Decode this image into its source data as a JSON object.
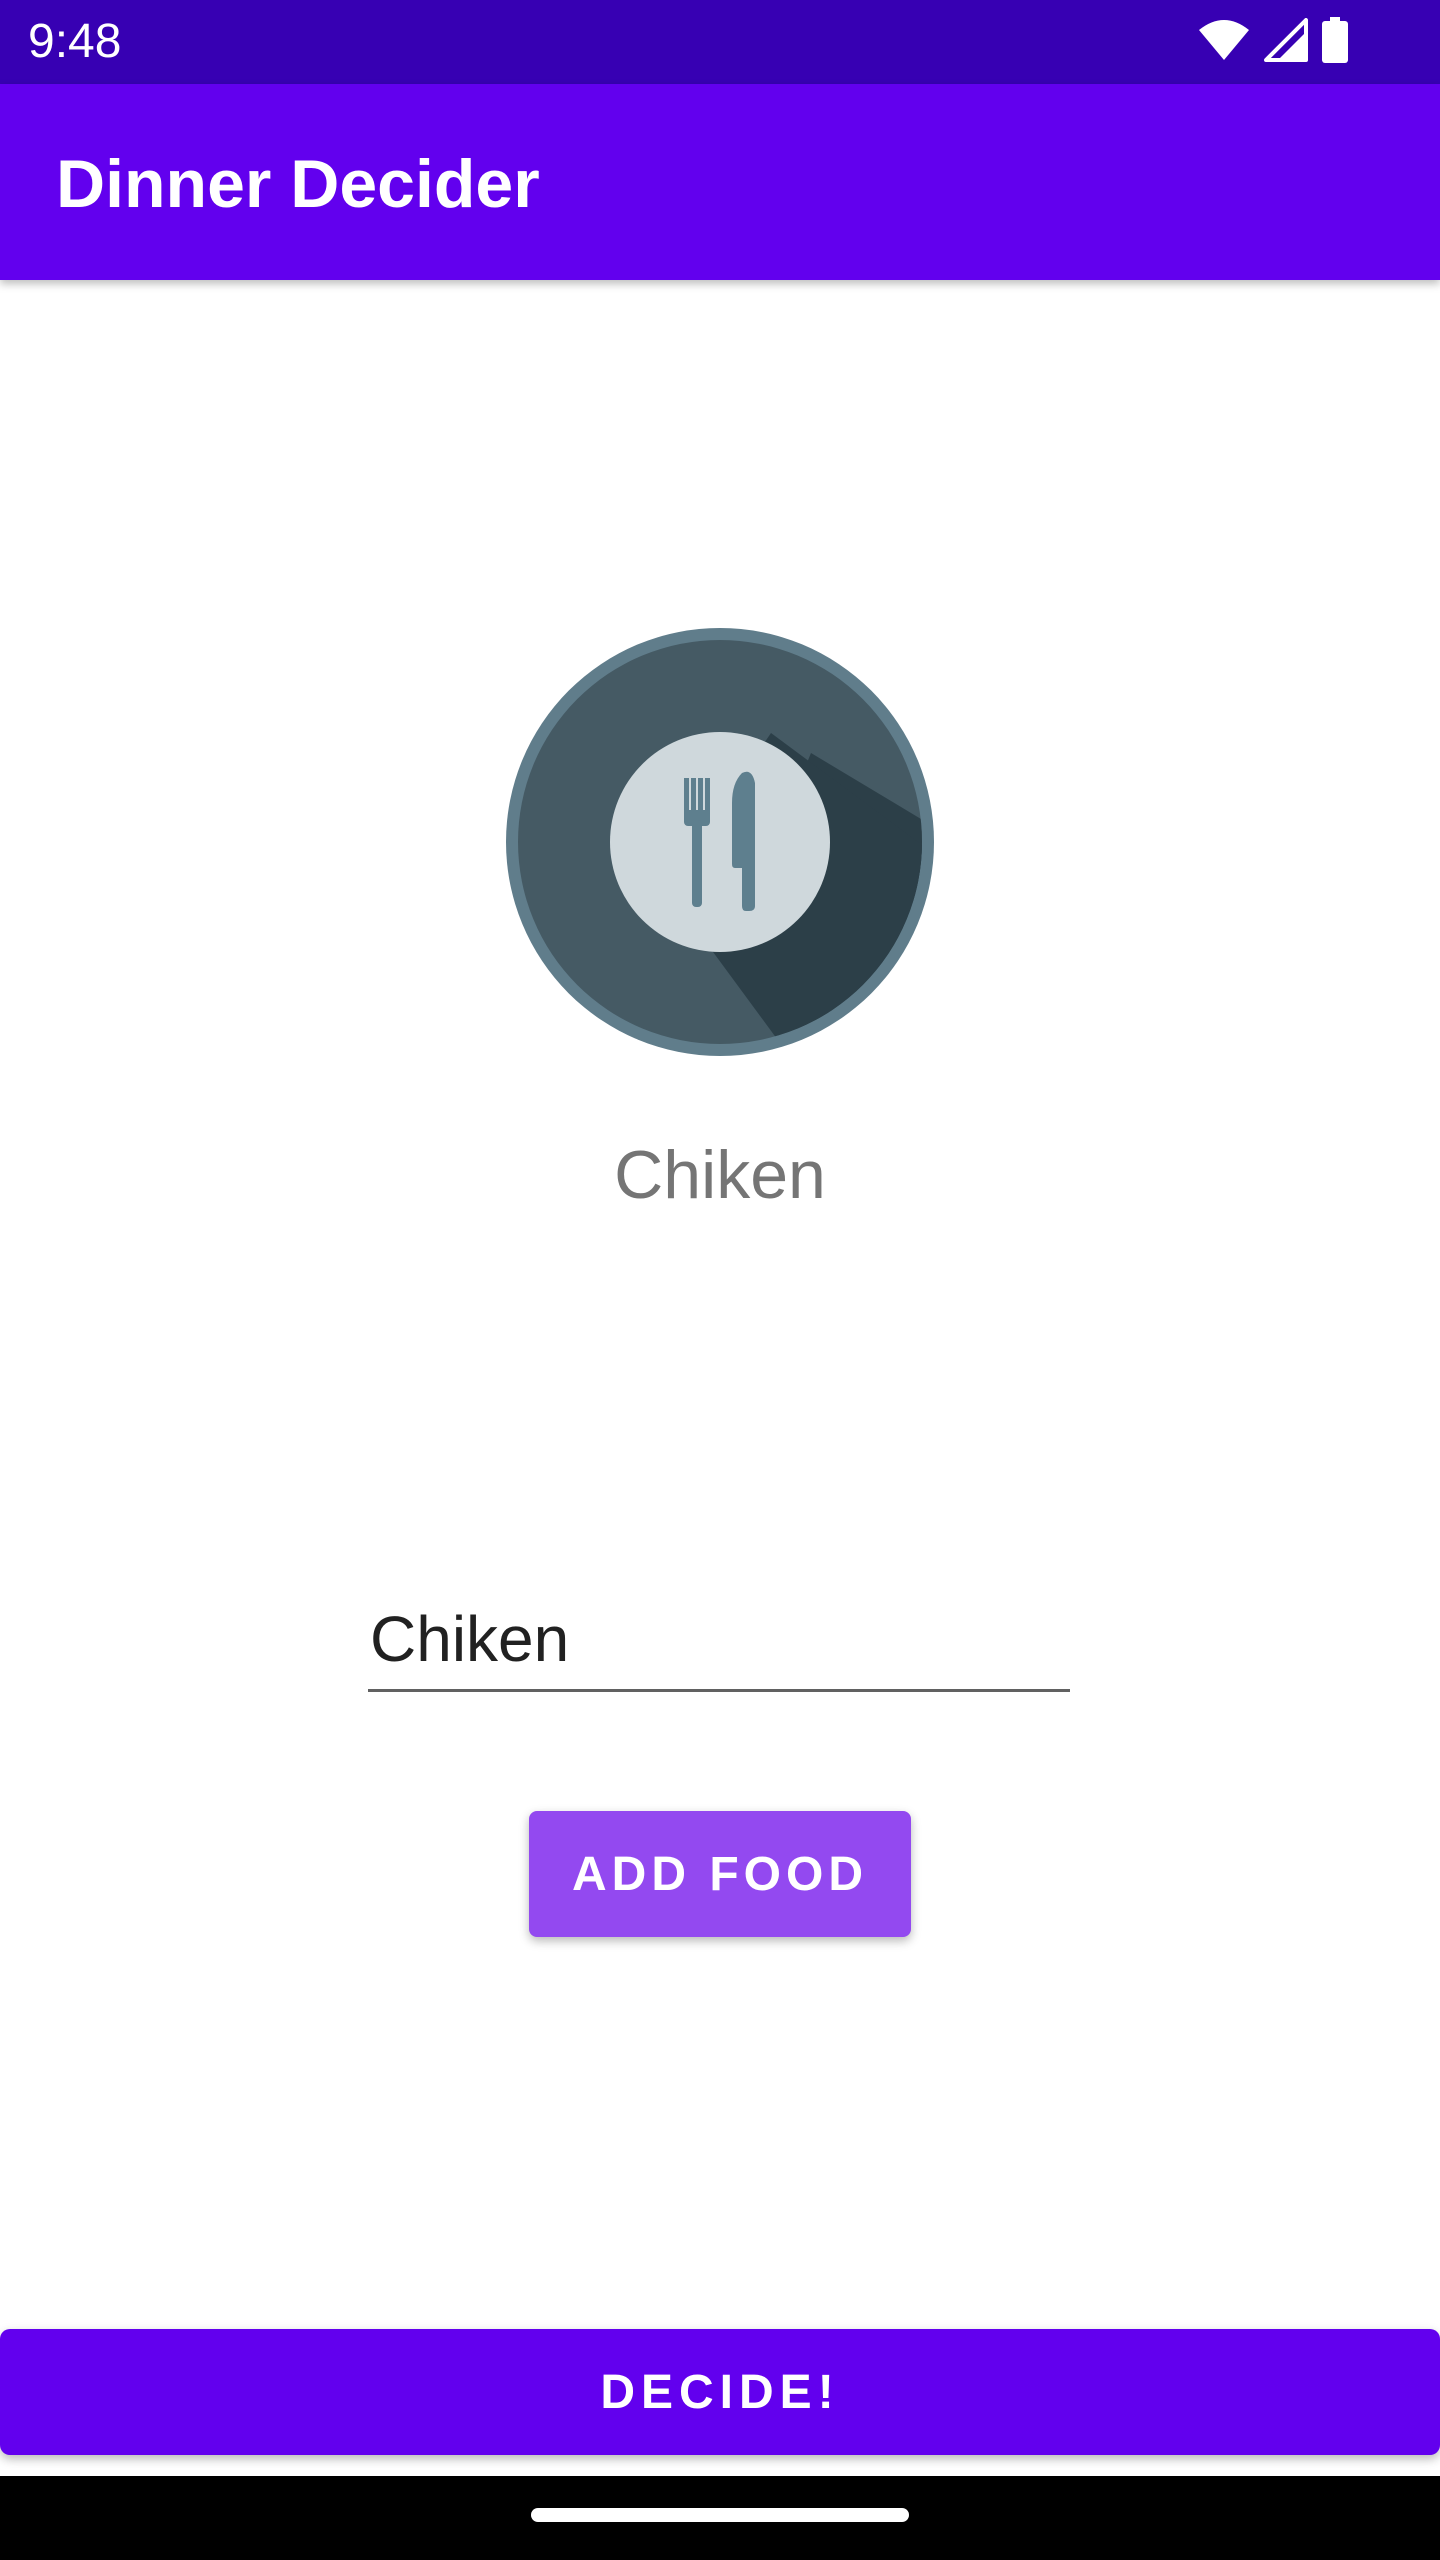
{
  "status_bar": {
    "time": "9:48",
    "icons": [
      "wifi-icon",
      "cell-signal-icon",
      "battery-icon"
    ],
    "background": "#3700b3"
  },
  "app_bar": {
    "title": "Dinner Decider",
    "background": "#6200ee"
  },
  "main": {
    "image_icon": "plate-fork-knife-icon",
    "selected_food": "Chiken",
    "food_input": {
      "value": "Chiken",
      "placeholder": ""
    },
    "add_food_label": "ADD FOOD",
    "add_food_color": "#9349f0"
  },
  "footer": {
    "decide_label": "DECIDE!",
    "decide_color": "#6200ee"
  }
}
